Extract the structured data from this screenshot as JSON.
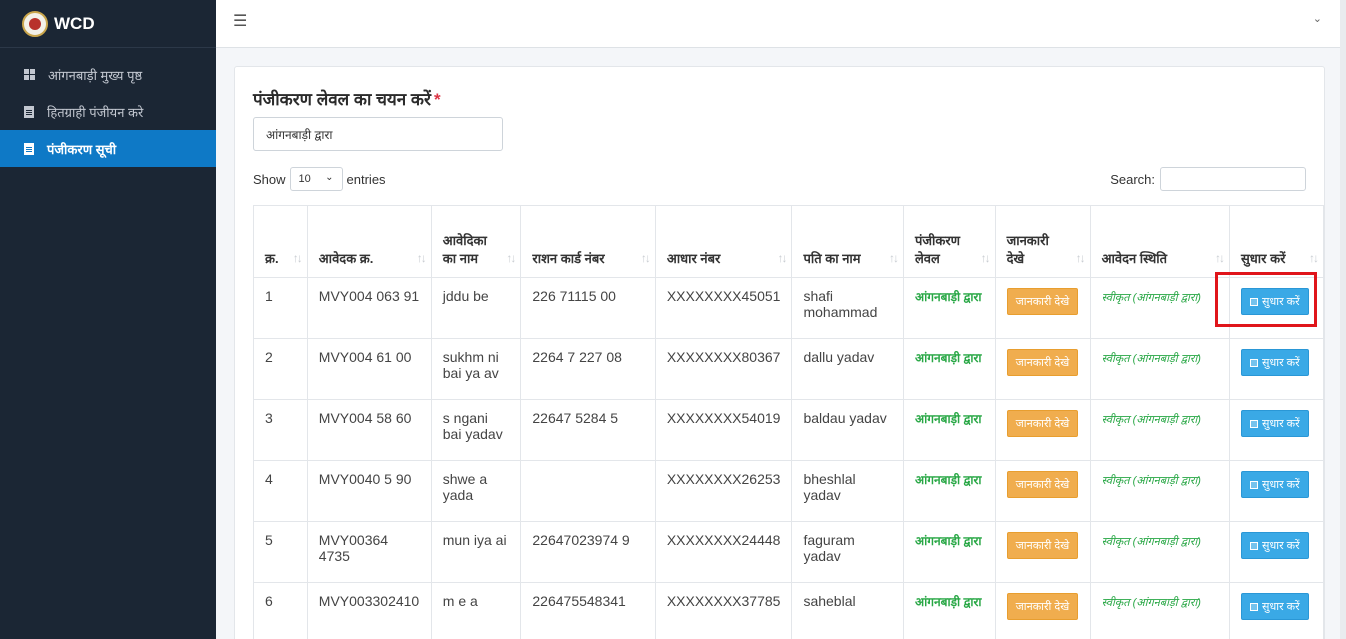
{
  "brand": {
    "title": "WCD"
  },
  "sidebar": {
    "items": [
      {
        "label": "आंगनबाड़ी मुख्य पृष्ठ",
        "icon": "dashboard-grid-icon"
      },
      {
        "label": "हितग्राही पंजीयन करे",
        "icon": "document-icon"
      },
      {
        "label": "पंजीकरण सूची",
        "icon": "document-icon",
        "active": true
      }
    ]
  },
  "form": {
    "title": "पंजीकरण लेवल का चयन करें",
    "required_mark": "*",
    "level_value": "आंगनबाड़ी द्वारा"
  },
  "table_controls": {
    "show_label": "Show",
    "page_length": "10",
    "entries_label": "entries",
    "search_label": "Search:"
  },
  "table": {
    "headers": [
      "क्र.",
      "आवेदक क्र.",
      "आवेदिका का नाम",
      "राशन कार्ड नंबर",
      "आधार नंबर",
      "पति का नाम",
      "पंजीकरण लेवल",
      "जानकारी देखे",
      "आवेदन स्थिति",
      "सुधार करें"
    ],
    "view_label": "जानकारी देखे",
    "edit_label": "सुधार करें",
    "rows": [
      {
        "sr": "1",
        "app_no": "MVY004 063 91",
        "name": "jddu be",
        "ration": "226 71115 00",
        "aadhaar": "XXXXXXXX45051",
        "husband": "shafi mohammad",
        "level": "आंगनबाड़ी द्वारा",
        "status": "स्वीकृत (आंगनबाड़ी द्वारा)"
      },
      {
        "sr": "2",
        "app_no": "MVY004 61 00",
        "name": "sukhm ni bai ya av",
        "ration": "2264 7 227 08",
        "aadhaar": "XXXXXXXX80367",
        "husband": "dallu yadav",
        "level": "आंगनबाड़ी द्वारा",
        "status": "स्वीकृत (आंगनबाड़ी द्वारा)"
      },
      {
        "sr": "3",
        "app_no": "MVY004 58 60",
        "name": "s ngani bai yadav",
        "ration": "22647 5284 5",
        "aadhaar": "XXXXXXXX54019",
        "husband": "baldau yadav",
        "level": "आंगनबाड़ी द्वारा",
        "status": "स्वीकृत (आंगनबाड़ी द्वारा)"
      },
      {
        "sr": "4",
        "app_no": "MVY0040 5 90",
        "name": "shwe a yada",
        "ration": "",
        "aadhaar": "XXXXXXXX26253",
        "husband": "bheshlal yadav",
        "level": "आंगनबाड़ी द्वारा",
        "status": "स्वीकृत (आंगनबाड़ी द्वारा)"
      },
      {
        "sr": "5",
        "app_no": "MVY00364 4735",
        "name": "mun iya ai",
        "ration": "22647023974 9",
        "aadhaar": "XXXXXXXX24448",
        "husband": "faguram yadav",
        "level": "आंगनबाड़ी द्वारा",
        "status": "स्वीकृत (आंगनबाड़ी द्वारा)"
      },
      {
        "sr": "6",
        "app_no": "MVY003302410",
        "name": "m e a",
        "ration": "226475548341",
        "aadhaar": "XXXXXXXX37785",
        "husband": "saheblal",
        "level": "आंगनबाड़ी द्वारा",
        "status": "स्वीकृत (आंगनबाड़ी द्वारा)"
      }
    ]
  },
  "colors": {
    "sidebar_bg": "#1b2634",
    "active_nav": "#0e79c6",
    "view_button": "#f0ad4e",
    "edit_button": "#3aa9e6",
    "status_green": "#28a745",
    "highlight": "#e0151b"
  }
}
